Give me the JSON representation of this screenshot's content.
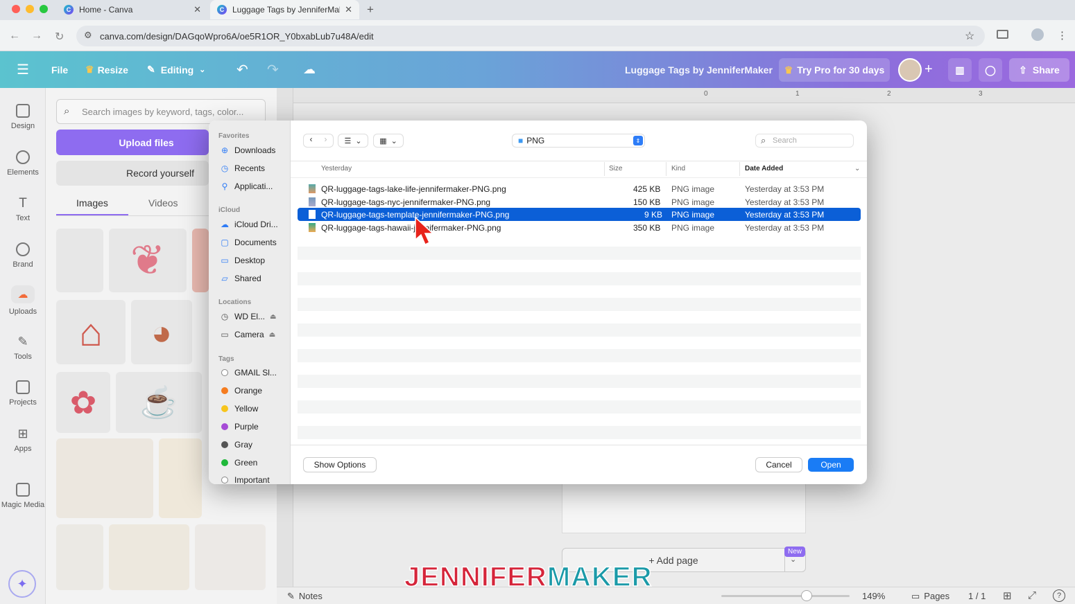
{
  "browser": {
    "tabs": [
      {
        "label": "Home - Canva"
      },
      {
        "label": "Luggage Tags by JenniferMal"
      }
    ],
    "url": "canva.com/design/DAGqoWpro6A/oe5R1OR_Y0bxabLub7u48A/edit"
  },
  "header": {
    "file": "File",
    "resize": "Resize",
    "editing": "Editing",
    "doc_title": "Luggage Tags by JenniferMaker",
    "try_pro": "Try Pro for 30 days",
    "share": "Share"
  },
  "rail": {
    "items": [
      "Design",
      "Elements",
      "Text",
      "Brand",
      "Uploads",
      "Tools",
      "Projects",
      "Apps",
      "Magic Media"
    ]
  },
  "panel": {
    "search_placeholder": "Search images by keyword, tags, color...",
    "upload": "Upload files",
    "record": "Record yourself",
    "tabs": [
      "Images",
      "Videos"
    ]
  },
  "ruler": [
    "0",
    "1",
    "2",
    "3"
  ],
  "bottom": {
    "notes": "Notes",
    "zoom": "149%",
    "pages": "Pages",
    "page_count": "1 / 1",
    "add_page": "+ Add page",
    "new_badge": "New"
  },
  "watermark": {
    "part1": "JENNIFER",
    "part2": "MAKER"
  },
  "dialog": {
    "folder": "PNG",
    "search_placeholder": "Search",
    "sidebar": {
      "favorites_label": "Favorites",
      "favorites": [
        "Downloads",
        "Recents",
        "Applicati..."
      ],
      "icloud_label": "iCloud",
      "icloud": [
        "iCloud Dri...",
        "Documents",
        "Desktop",
        "Shared"
      ],
      "locations_label": "Locations",
      "locations": [
        "WD El...",
        "Camera"
      ],
      "tags_label": "Tags",
      "tags": [
        {
          "name": "GMAIL Sl...",
          "color": "#ffffff"
        },
        {
          "name": "Orange",
          "color": "#f57c1f"
        },
        {
          "name": "Yellow",
          "color": "#f7c51c"
        },
        {
          "name": "Purple",
          "color": "#a64bd6"
        },
        {
          "name": "Gray",
          "color": "#8e8e93"
        },
        {
          "name": "Green",
          "color": "#34c759"
        },
        {
          "name": "Important",
          "color": "#ffffff"
        }
      ]
    },
    "group_label": "Yesterday",
    "columns": {
      "size": "Size",
      "kind": "Kind",
      "date": "Date Added"
    },
    "files": [
      {
        "name": "QR-luggage-tags-lake-life-jennifermaker-PNG.png",
        "size": "425 KB",
        "kind": "PNG image",
        "date": "Yesterday at 3:53 PM"
      },
      {
        "name": "QR-luggage-tags-nyc-jennifermaker-PNG.png",
        "size": "150 KB",
        "kind": "PNG image",
        "date": "Yesterday at 3:53 PM"
      },
      {
        "name": "QR-luggage-tags-template-jennifermaker-PNG.png",
        "size": "9 KB",
        "kind": "PNG image",
        "date": "Yesterday at 3:53 PM"
      },
      {
        "name": "QR-luggage-tags-hawaii-jennifermaker-PNG.png",
        "size": "350 KB",
        "kind": "PNG image",
        "date": "Yesterday at 3:53 PM"
      }
    ],
    "selected_index": 2,
    "show_options": "Show Options",
    "cancel": "Cancel",
    "open": "Open"
  }
}
